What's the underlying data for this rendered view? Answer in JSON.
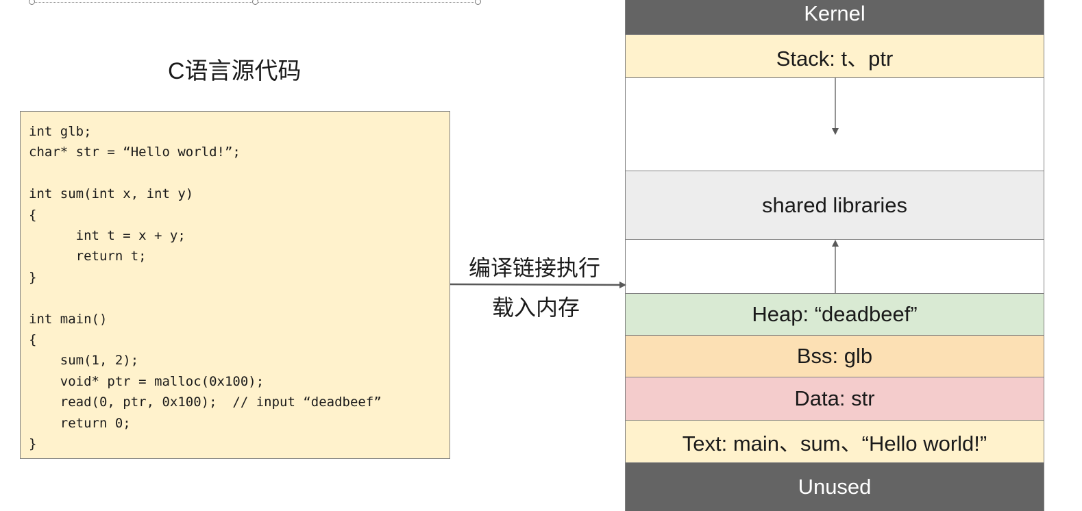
{
  "source": {
    "title": "C语言源代码",
    "code_lines": [
      "int glb;",
      "char* str = “Hello world!”;",
      "",
      "int sum(int x, int y)",
      "{",
      "      int t = x + y;",
      "      return t;",
      "}",
      "",
      "int main()",
      "{",
      "    sum(1, 2);",
      "    void* ptr = malloc(0x100);",
      "    read(0, ptr, 0x100);  // input “deadbeef”",
      "    return 0;",
      "}"
    ]
  },
  "arrow": {
    "label_top": "编译链接执行",
    "label_bottom": "载入内存"
  },
  "memory": {
    "segments": [
      {
        "id": "kernel",
        "label": "Kernel",
        "color": "#646464",
        "text_color": "#ffffff"
      },
      {
        "id": "stack",
        "label": "Stack: t、ptr",
        "color": "#fff2cc"
      },
      {
        "id": "free-upper",
        "label": "",
        "color": "#ffffff"
      },
      {
        "id": "shared-libraries",
        "label": "shared libraries",
        "color": "#ededed"
      },
      {
        "id": "free-lower",
        "label": "",
        "color": "#ffffff"
      },
      {
        "id": "heap",
        "label": "Heap: “deadbeef”",
        "color": "#d9ead3"
      },
      {
        "id": "bss",
        "label": "Bss: glb",
        "color": "#fce0b4"
      },
      {
        "id": "data",
        "label": "Data: str",
        "color": "#f4cccc"
      },
      {
        "id": "text",
        "label": "Text: main、sum、“Hello world!”",
        "color": "#fff2cc"
      },
      {
        "id": "unused",
        "label": "Unused",
        "color": "#646464",
        "text_color": "#ffffff"
      }
    ]
  },
  "colors": {
    "code_background": "#fff2cc",
    "border": "#7f7f7f",
    "arrow": "#595959"
  }
}
